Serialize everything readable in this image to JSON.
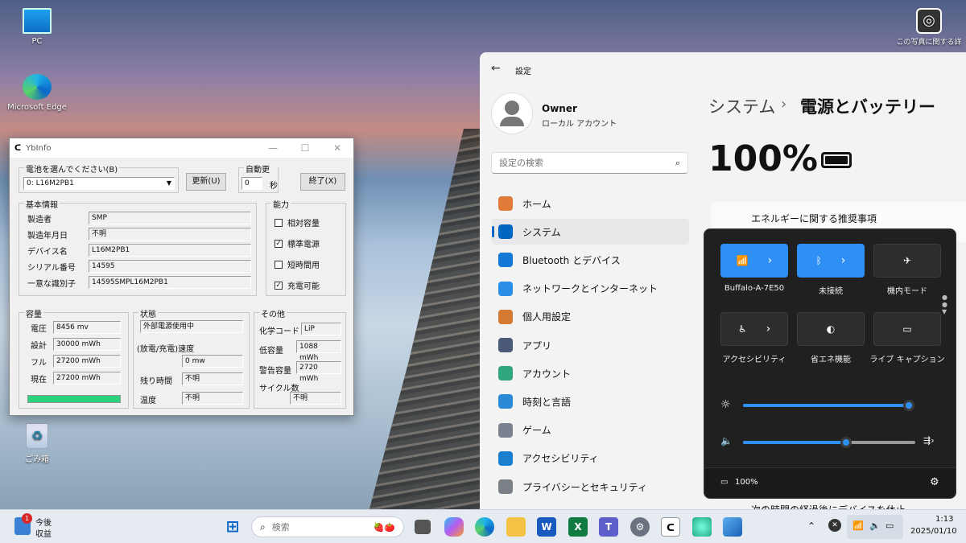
{
  "desktop": {
    "pc": "PC",
    "edge": "Microsoft Edge",
    "recycle": "ごみ箱",
    "photo_info": "この写真に関する詳"
  },
  "ybinfo": {
    "title": "YbInfo",
    "select_group": "電池を選んでください(B)",
    "battery_value": "0: L16M2PB1",
    "update_btn": "更新(U)",
    "auto_group": "自動更新",
    "auto_value": "0",
    "auto_unit": "秒",
    "exit_btn": "終了(X)",
    "basic_group": "基本情報",
    "basic": [
      {
        "label": "製造者",
        "value": "SMP"
      },
      {
        "label": "製造年月日",
        "value": "不明"
      },
      {
        "label": "デバイス名",
        "value": "L16M2PB1"
      },
      {
        "label": "シリアル番号",
        "value": "14595"
      },
      {
        "label": "一意な識別子",
        "value": "14595SMPL16M2PB1"
      }
    ],
    "cap_group": "能力",
    "caps": [
      {
        "label": "相対容量",
        "checked": false,
        "mark": ""
      },
      {
        "label": "標準電源",
        "checked": true,
        "mark": "✓"
      },
      {
        "label": "短時間用",
        "checked": false,
        "mark": ""
      },
      {
        "label": "充電可能",
        "checked": true,
        "mark": "✓"
      }
    ],
    "capacity_group": "容量",
    "capacity": [
      {
        "label": "電圧",
        "value": "8456 mv"
      },
      {
        "label": "設計",
        "value": "30000 mWh"
      },
      {
        "label": "フル",
        "value": "27200 mWh"
      },
      {
        "label": "現在",
        "value": "27200 mWh"
      }
    ],
    "capacity_level": 1.0,
    "state_group": "状態",
    "state_value": "外部電源使用中",
    "rate_label": "(放電/充電)速度",
    "rate_value": "0 mw",
    "remain_label": "残り時間",
    "remain_value": "不明",
    "temp_label": "温度",
    "temp_value": "不明",
    "other_group": "その他",
    "chem_label": "化学コード",
    "chem_value": "LiP",
    "low_label": "低容量",
    "low_value": "1088 mWh",
    "warn_label": "警告容量",
    "warn_value": "2720 mWh",
    "cycle_label": "サイクル数",
    "cycle_value": "不明"
  },
  "settings": {
    "app_title": "設定",
    "user": "Owner",
    "account": "ローカル アカウント",
    "search_placeholder": "設定の検索",
    "breadcrumb_parent": "システム",
    "breadcrumb_sep": "›",
    "breadcrumb_current": "電源とバッテリー",
    "battery_percent": "100%",
    "energy_card": "エネルギーに関する推奨事項",
    "bottom_text": "次の時間の経過後にデバイスを休止",
    "nav": [
      {
        "label": "ホーム",
        "color": "#e07b39"
      },
      {
        "label": "システム",
        "color": "#0067c0"
      },
      {
        "label": "Bluetooth とデバイス",
        "color": "#1479d6"
      },
      {
        "label": "ネットワークとインターネット",
        "color": "#2b8ee6"
      },
      {
        "label": "個人用設定",
        "color": "#d47a33"
      },
      {
        "label": "アプリ",
        "color": "#4a5a76"
      },
      {
        "label": "アカウント",
        "color": "#2fa57e"
      },
      {
        "label": "時刻と言語",
        "color": "#2c89d8"
      },
      {
        "label": "ゲーム",
        "color": "#7a8190"
      },
      {
        "label": "アクセシビリティ",
        "color": "#1b7fd0"
      },
      {
        "label": "プライバシーとセキュリティ",
        "color": "#7b7f86"
      }
    ]
  },
  "quick": {
    "tiles": [
      {
        "label": "Buffalo-A-7E50",
        "glyph": "📶",
        "arrow": "›"
      },
      {
        "label": "未接続",
        "glyph": "ᛒ",
        "arrow": "›"
      },
      {
        "label": "機内モード",
        "glyph": "✈"
      },
      {
        "label": "アクセシビリティ",
        "glyph": "♿",
        "arrow": "›"
      },
      {
        "label": "省エネ機能",
        "glyph": "◐"
      },
      {
        "label": "ライブ キャプション",
        "glyph": "▭"
      }
    ],
    "brightness": 0.98,
    "volume": 0.6,
    "battery": "100%"
  },
  "taskbar": {
    "widget_title": "今後",
    "widget_sub": "収益",
    "widget_badge": "1",
    "search_placeholder": "検索",
    "time": "1:13",
    "date": "2025/01/10"
  }
}
